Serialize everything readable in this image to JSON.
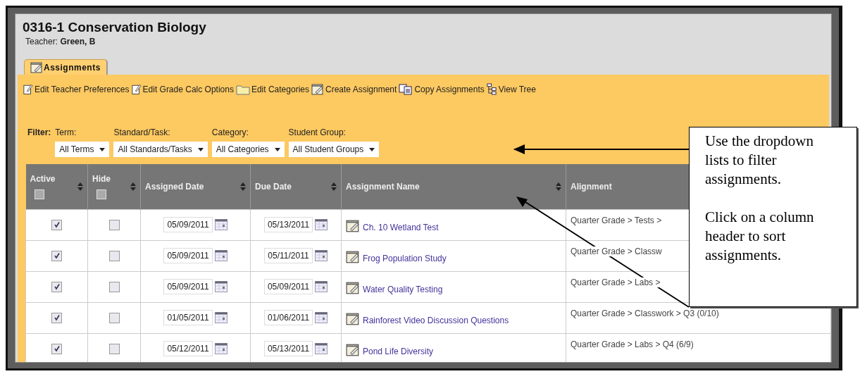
{
  "course": {
    "title": "0316-1 Conservation Biology",
    "teacher_label": "Teacher:",
    "teacher_name": "Green, B"
  },
  "tabs": [
    {
      "label": "Assignments",
      "selected": true
    }
  ],
  "toolbar": [
    {
      "label": "Edit Teacher Preferences",
      "kind": "note"
    },
    {
      "label": "Edit Grade Calc Options",
      "kind": "note"
    },
    {
      "label": "Edit Categories",
      "kind": "folder"
    },
    {
      "label": "Create Assignment",
      "kind": "pad"
    },
    {
      "label": "Copy Assignments",
      "kind": "copy"
    },
    {
      "label": "View Tree",
      "kind": "tree"
    }
  ],
  "filter": {
    "label": "Filter:",
    "fields": [
      {
        "label": "Term:",
        "value": "All Terms"
      },
      {
        "label": "Standard/Task:",
        "value": "All Standards/Tasks"
      },
      {
        "label": "Category:",
        "value": "All Categories"
      },
      {
        "label": "Student Group:",
        "value": "All Student Groups"
      }
    ]
  },
  "table": {
    "columns": [
      {
        "label": "Active",
        "sortable": true,
        "header_checkbox": {
          "checked": false
        }
      },
      {
        "label": "Hide",
        "sortable": true,
        "header_checkbox": {
          "checked": false
        }
      },
      {
        "label": "Assigned Date",
        "sortable": true
      },
      {
        "label": "Due Date",
        "sortable": true
      },
      {
        "label": "Assignment Name",
        "sortable": true
      },
      {
        "label": "Alignment"
      }
    ],
    "rows": [
      {
        "active": true,
        "hide": false,
        "assigned": "05/09/2011",
        "due": "05/13/2011",
        "name": "Ch. 10 Wetland Test",
        "alignment": "Quarter Grade > Tests >"
      },
      {
        "active": true,
        "hide": false,
        "assigned": "05/09/2011",
        "due": "05/11/2011",
        "name": "Frog Population Study",
        "alignment": "Quarter Grade > Classw"
      },
      {
        "active": true,
        "hide": false,
        "assigned": "05/09/2011",
        "due": "05/09/2011",
        "name": "Water Quality Testing",
        "alignment": "Quarter Grade > Labs >"
      },
      {
        "active": true,
        "hide": false,
        "assigned": "01/05/2011",
        "due": "01/06/2011",
        "name": "Rainforest Video Discussion Questions",
        "alignment": "Quarter Grade > Classwork > Q3 (0/10)"
      },
      {
        "active": true,
        "hide": false,
        "assigned": "05/12/2011",
        "due": "05/13/2011",
        "name": "Pond Life Diversity",
        "alignment": "Quarter Grade > Labs > Q4 (6/9)"
      }
    ]
  },
  "callout": {
    "paragraphs": [
      "Use the dropdown lists to filter assignments.",
      "Click on a column header to sort assignments."
    ]
  }
}
